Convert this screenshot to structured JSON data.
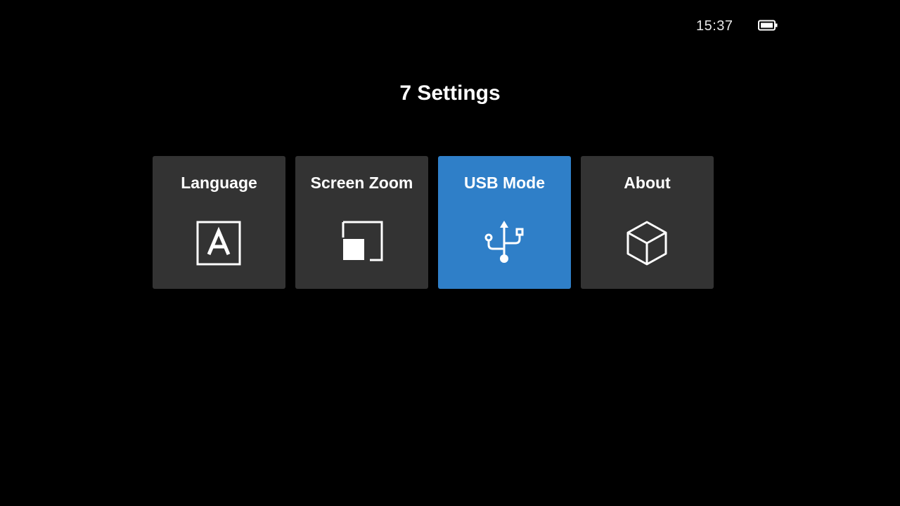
{
  "status": {
    "time": "15:37",
    "battery_icon": "battery-full-icon"
  },
  "title": "7 Settings",
  "tiles": [
    {
      "label": "Language",
      "icon": "language-letter-a-icon",
      "selected": false
    },
    {
      "label": "Screen Zoom",
      "icon": "screen-zoom-icon",
      "selected": false
    },
    {
      "label": "USB Mode",
      "icon": "usb-icon",
      "selected": true
    },
    {
      "label": "About",
      "icon": "cube-icon",
      "selected": false
    }
  ],
  "colors": {
    "background": "#000000",
    "tile": "#333333",
    "tile_selected": "#2f7fc8",
    "text": "#ffffff"
  }
}
